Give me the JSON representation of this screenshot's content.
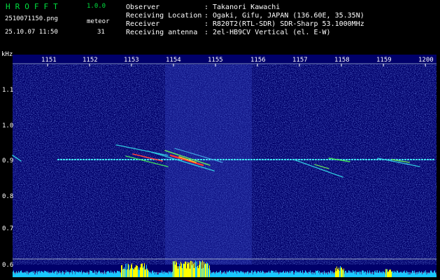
{
  "header": {
    "app_name": "HROFFT",
    "version": "1.0.0",
    "file_name": "2510071150.png",
    "meteor_label": "meteor",
    "timestamp": "25.10.07 11:50",
    "meteor_count": "31"
  },
  "info": [
    {
      "key": "Observer",
      "value": "Takanori Kawachi"
    },
    {
      "key": "Receiving Location",
      "value": "Ogaki, Gifu, JAPAN (136.60E, 35.35N)"
    },
    {
      "key": "Receiver",
      "value": "R820T2(RTL-SDR) SDR-Sharp 53.1000MHz"
    },
    {
      "key": "Receiving antenna",
      "value": "2el-HB9CV Vertical (el. E-W)"
    }
  ],
  "axes": {
    "y_unit": "kHz",
    "x_ticks": [
      "1151",
      "1152",
      "1153",
      "1154",
      "1155",
      "1156",
      "1157",
      "1158",
      "1159",
      "1200"
    ],
    "y_ticks": [
      "1.1",
      "1.0",
      "0.9",
      "0.8",
      "0.7",
      "0.6"
    ]
  },
  "colors": {
    "background": "#00006a",
    "noise": "#2a3aa8",
    "carrier": "#35d2e8",
    "meteor_hot": "#ff3030",
    "level_bar": "#19c8ff",
    "level_peak": "#ffff00",
    "logo": "#00e040"
  }
}
